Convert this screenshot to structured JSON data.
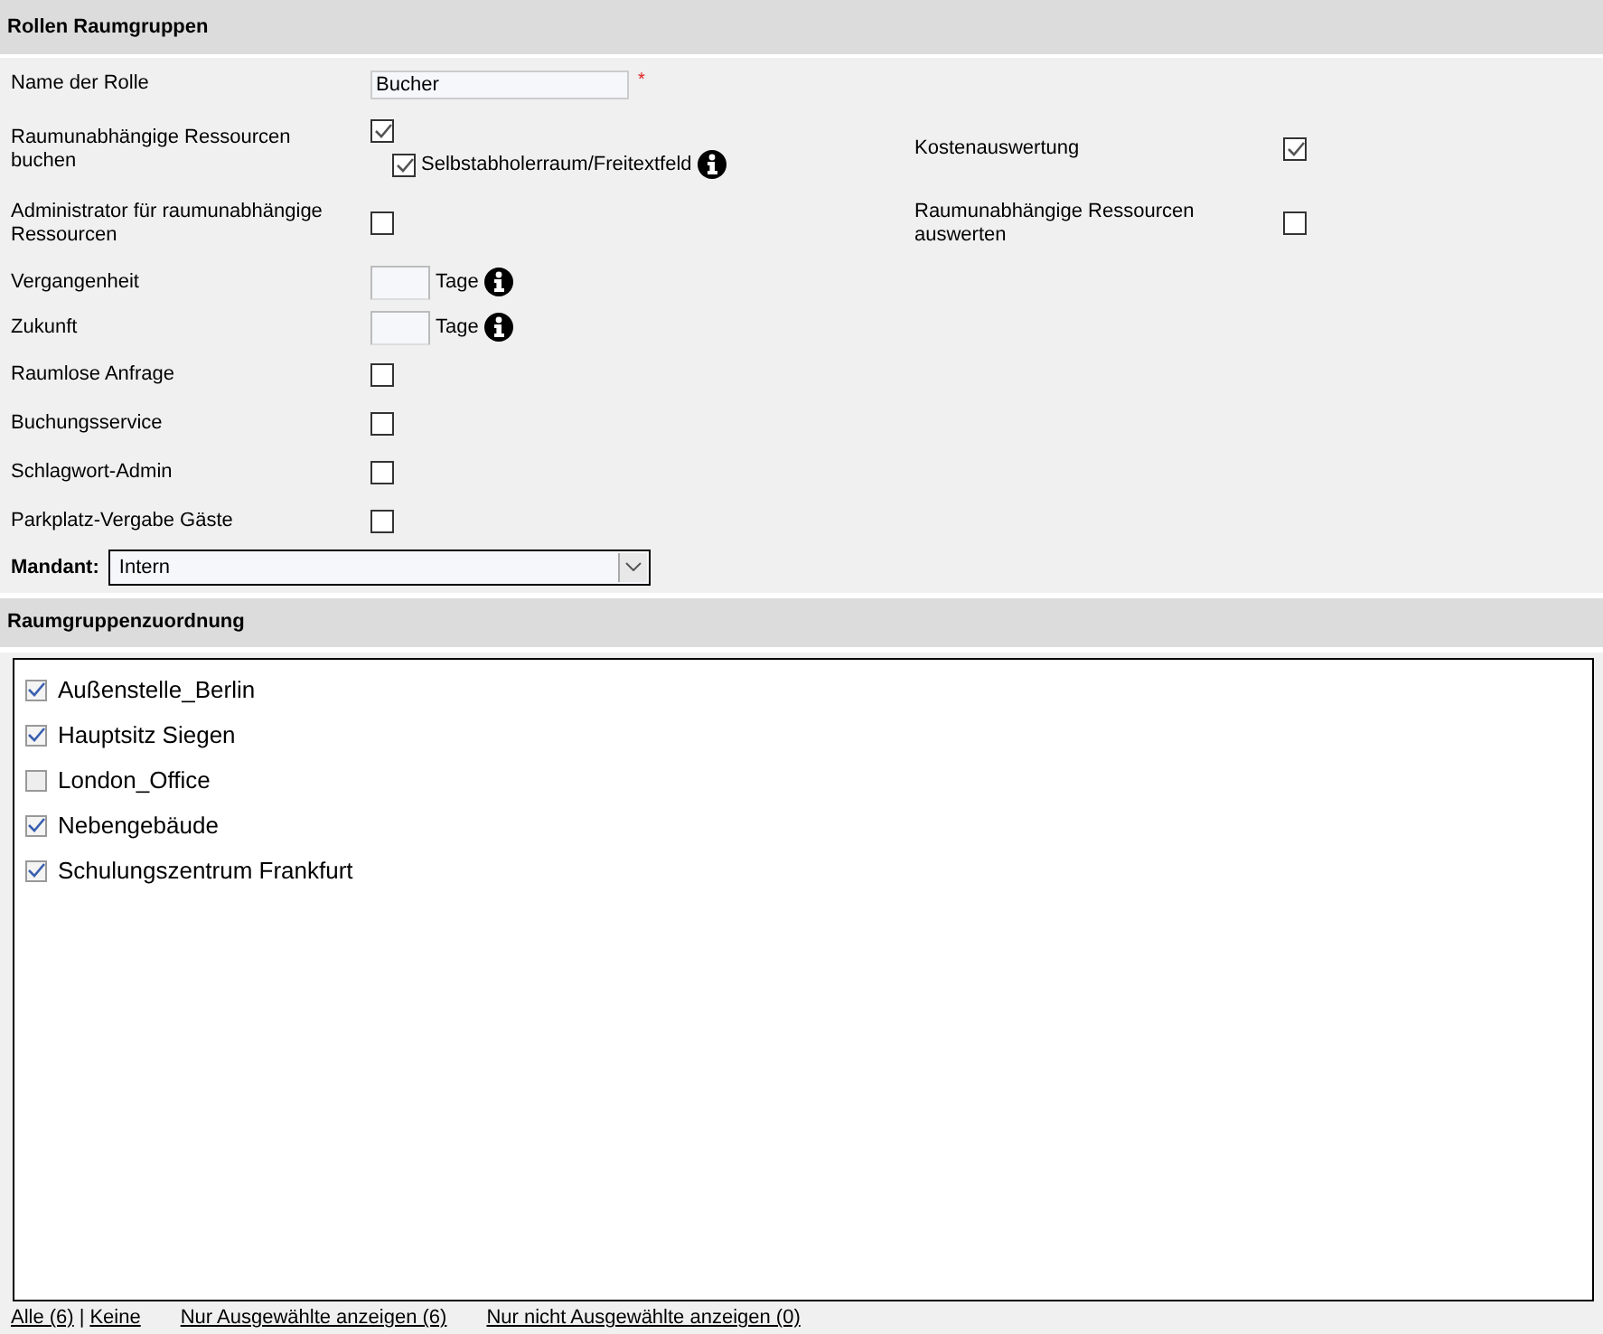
{
  "header": {
    "title": "Rollen Raumgruppen"
  },
  "fields": [
    {
      "kind": "text",
      "label": "Name der Rolle",
      "value": "Bucher",
      "required_mark": "*"
    },
    {
      "kind": "checkbox",
      "label": "Raumunabhängige Ressourcen buchen",
      "checked": true,
      "sub": {
        "label": "Selbstabholerraum/Freitextfeld",
        "checked": true
      },
      "right": {
        "label": "Kostenauswertung",
        "checked": true
      }
    },
    {
      "kind": "checkbox",
      "label": "Administrator für raumunabhängige Ressourcen",
      "checked": false,
      "right": {
        "label": "Raumunabhängige Ressourcen auswerten",
        "checked": false
      }
    },
    {
      "kind": "days",
      "label": "Vergangenheit",
      "unit": "Tage"
    },
    {
      "kind": "days",
      "label": "Zukunft",
      "unit": "Tage"
    },
    {
      "kind": "checkbox",
      "label": "Raumlose Anfrage",
      "checked": false
    },
    {
      "kind": "checkbox",
      "label": "Buchungsservice",
      "checked": false
    },
    {
      "kind": "checkbox",
      "label": "Schlagwort-Admin",
      "checked": false
    },
    {
      "kind": "checkbox",
      "label": "Parkplatz-Vergabe Gäste",
      "checked": false
    }
  ],
  "mandant": {
    "label": "Mandant:",
    "value": "Intern"
  },
  "section": {
    "title": "Raumgruppenzuordnung"
  },
  "groups": [
    {
      "label": "Außenstelle_Berlin",
      "checked": true
    },
    {
      "label": "Hauptsitz Siegen",
      "checked": true
    },
    {
      "label": "London_Office",
      "checked": false
    },
    {
      "label": "Nebengebäude",
      "checked": true
    },
    {
      "label": "Schulungszentrum Frankfurt",
      "checked": true
    }
  ],
  "footer_links": [
    {
      "label": "Alle (6)",
      "separator": "|"
    },
    {
      "label": "Keine"
    },
    {
      "label": "Nur Ausgewählte anzeigen (6)"
    },
    {
      "label": "Nur nicht Ausgewählte anzeigen (0)"
    }
  ]
}
